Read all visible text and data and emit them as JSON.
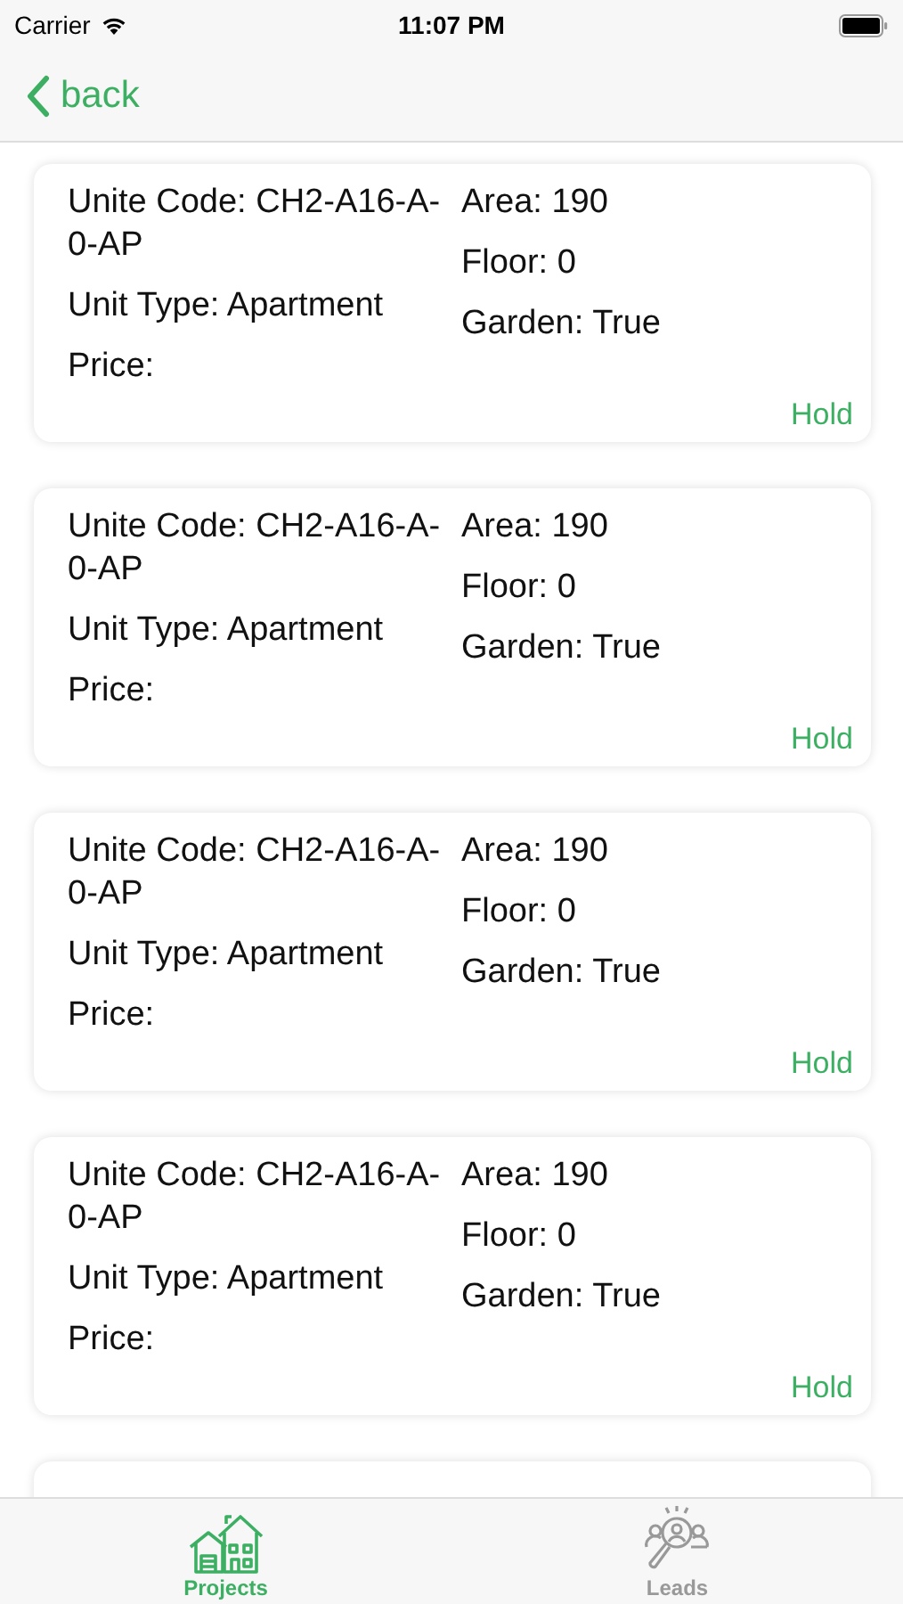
{
  "status_bar": {
    "carrier": "Carrier",
    "time": "11:07 PM"
  },
  "nav": {
    "back": "back"
  },
  "units": [
    {
      "code": "Unite Code: CH2-A16-A-0-AP",
      "type": "Unit Type: Apartment",
      "price": "Price:",
      "area": "Area: 190",
      "floor": "Floor: 0",
      "garden": "Garden: True",
      "status": "Hold"
    },
    {
      "code": "Unite Code: CH2-A16-A-0-AP",
      "type": "Unit Type: Apartment",
      "price": "Price:",
      "area": "Area: 190",
      "floor": "Floor: 0",
      "garden": "Garden: True",
      "status": "Hold"
    },
    {
      "code": "Unite Code: CH2-A16-A-0-AP",
      "type": "Unit Type: Apartment",
      "price": "Price:",
      "area": "Area: 190",
      "floor": "Floor: 0",
      "garden": "Garden: True",
      "status": "Hold"
    },
    {
      "code": "Unite Code: CH2-A16-A-0-AP",
      "type": "Unit Type: Apartment",
      "price": "Price:",
      "area": "Area: 190",
      "floor": "Floor: 0",
      "garden": "Garden: True",
      "status": "Hold"
    }
  ],
  "tabs": [
    {
      "label": "Projects",
      "kind": "projects",
      "selected": true
    },
    {
      "label": "Leads",
      "kind": "leads",
      "selected": false
    }
  ]
}
